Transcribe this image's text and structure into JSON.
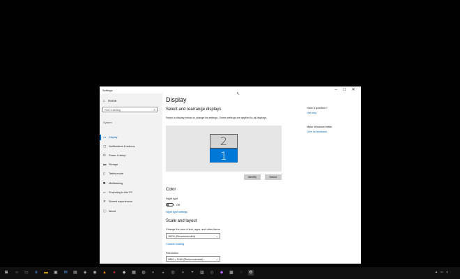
{
  "window": {
    "title": "Settings",
    "controls": {
      "minimize": "–",
      "maximize": "□",
      "close": "✕"
    }
  },
  "sidebar": {
    "home": "Home",
    "search_placeholder": "Find a setting",
    "section": "System",
    "items": [
      {
        "label": "Display",
        "icon": "display-icon"
      },
      {
        "label": "Notifications & actions",
        "icon": "notifications-icon"
      },
      {
        "label": "Power & sleep",
        "icon": "power-icon"
      },
      {
        "label": "Storage",
        "icon": "storage-icon"
      },
      {
        "label": "Tablet mode",
        "icon": "tablet-icon"
      },
      {
        "label": "Multitasking",
        "icon": "multitasking-icon"
      },
      {
        "label": "Projecting to this PC",
        "icon": "projecting-icon"
      },
      {
        "label": "Shared experiences",
        "icon": "shared-icon"
      },
      {
        "label": "About",
        "icon": "info-icon"
      }
    ]
  },
  "main": {
    "title": "Display",
    "rearrange_heading": "Select and rearrange displays",
    "rearrange_desc": "Select a display below to change its settings. Some settings are applied to all displays.",
    "monitor_2": "2",
    "monitor_1": "1",
    "identify": "Identify",
    "detect": "Detect",
    "color_heading": "Color",
    "night_light_label": "Night light",
    "night_light_state": "Off",
    "night_light_settings": "Night light settings",
    "scale_heading": "Scale and layout",
    "scale_label": "Change the size of text, apps, and other items",
    "scale_value": "150% (Recommended)",
    "custom_scaling": "Custom scaling",
    "resolution_label": "Resolution",
    "resolution_value": "3840 × 2160 (Recommended)"
  },
  "right_panel": {
    "question": "Have a question?",
    "get_help": "Get help",
    "better": "Make Windows better.",
    "feedback": "Give us feedback"
  },
  "colors": {
    "accent": "#0078d7",
    "link": "#0067b8"
  }
}
